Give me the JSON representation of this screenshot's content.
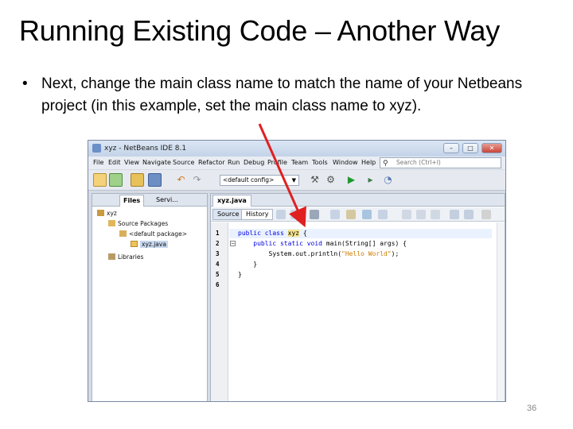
{
  "slide": {
    "title": "Running Existing Code – Another Way",
    "bullet_marker": "•",
    "bullet_text": "Next, change the main class name to match the name of your Netbeans project (in this example, set the main class name to xyz).",
    "number": "36"
  },
  "ide": {
    "window_title": "xyz - NetBeans IDE 8.1",
    "window_buttons": [
      "–",
      "□",
      "✕"
    ],
    "menu": [
      "File",
      "Edit",
      "View",
      "Navigate",
      "Source",
      "Refactor",
      "Run",
      "Debug",
      "Profile",
      "Team",
      "Tools",
      "Window",
      "Help"
    ],
    "search_placeholder": "Search (Ctrl+I)",
    "config_value": "<default config>",
    "panel_tabs": [
      "Files",
      "Servi..."
    ],
    "tree": [
      {
        "label": "xyz"
      },
      {
        "label": "Source Packages"
      },
      {
        "label": "<default package>"
      },
      {
        "label": "xyz.java"
      },
      {
        "label": "Libraries"
      }
    ],
    "editor_tab": "xyz.java",
    "editor_subtabs": [
      "Source",
      "History"
    ],
    "line_numbers": [
      "1",
      "2",
      "3",
      "4",
      "5",
      "6"
    ],
    "code": {
      "l1_kw": "public class ",
      "l1_cls": "xyz",
      "l1_rest": " {",
      "l2_kw": "    public static void ",
      "l2_rest": "main(String[] args) {",
      "l3_pre": "        System.out.println(",
      "l3_str": "\"Hello World\"",
      "l3_post": ");",
      "l4": "    }",
      "l5": "}"
    }
  },
  "colors": {
    "arrow": "#e02020",
    "keyword": "#0000e6",
    "string": "#ce7b00"
  }
}
